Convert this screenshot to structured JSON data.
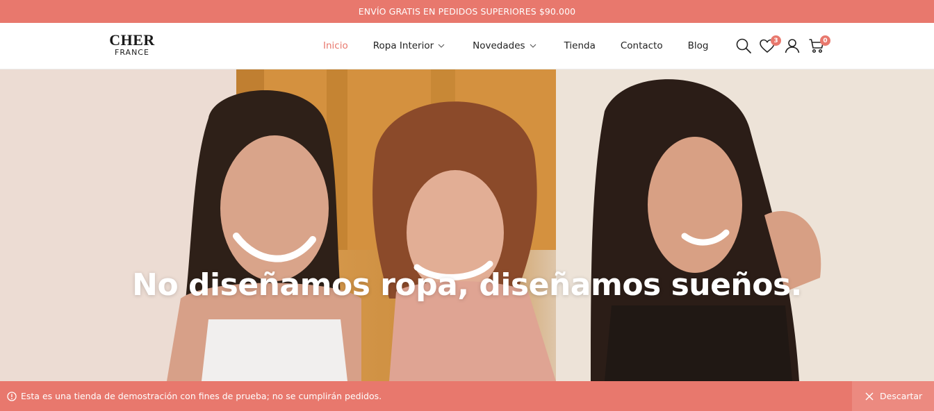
{
  "topbar": {
    "text": "ENVÍO GRATIS EN PEDIDOS SUPERIORES $90.000"
  },
  "logo": {
    "main": "CHER",
    "sub": "FRANCE"
  },
  "nav": {
    "items": [
      {
        "label": "Inicio",
        "active": true,
        "dropdown": false
      },
      {
        "label": "Ropa Interior",
        "active": false,
        "dropdown": true
      },
      {
        "label": "Novedades",
        "active": false,
        "dropdown": true
      },
      {
        "label": "Tienda",
        "active": false,
        "dropdown": false
      },
      {
        "label": "Contacto",
        "active": false,
        "dropdown": false
      },
      {
        "label": "Blog",
        "active": false,
        "dropdown": false
      }
    ]
  },
  "header_icons": {
    "search": "search-icon",
    "wishlist": {
      "icon": "heart-icon",
      "count": "3"
    },
    "account": "user-icon",
    "cart": {
      "icon": "cart-icon",
      "count": "0"
    }
  },
  "hero": {
    "title": "No diseñamos ropa, diseñamos sueños."
  },
  "notice": {
    "icon": "info-icon",
    "message": "Esta es una tienda de demostración con fines de prueba; no se cumplirán pedidos.",
    "dismiss_label": "Descartar",
    "dismiss_icon": "close-icon"
  },
  "colors": {
    "accent": "#e8786d",
    "text": "#222222",
    "background": "#ffffff"
  }
}
